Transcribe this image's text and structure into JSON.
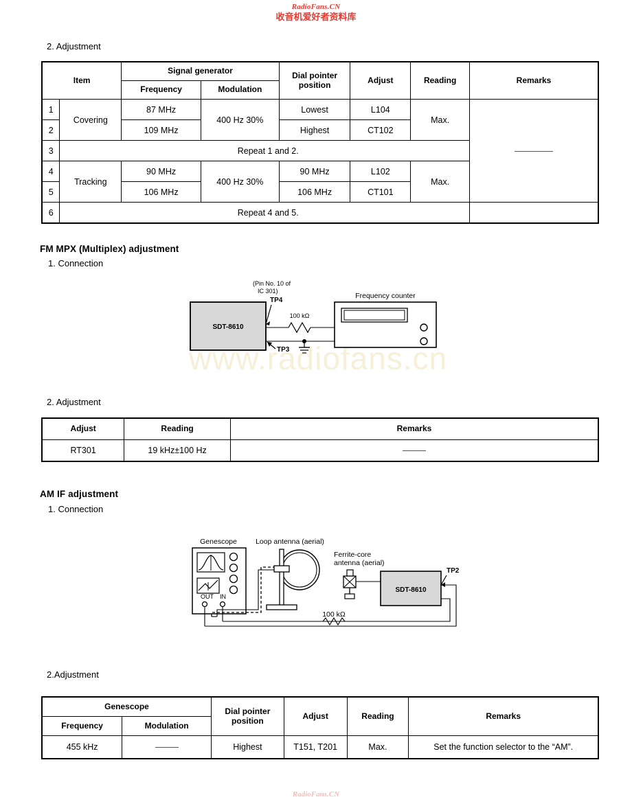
{
  "watermarks": {
    "top_latin": "RadioFans.CN",
    "top_cjk": "收音机爱好者资料库",
    "center": "www.radiofans.cn",
    "bottom": "RadioFans.CN"
  },
  "fm_rf": {
    "step_label": "2. Adjustment",
    "table": {
      "headers": {
        "item": "Item",
        "signal_generator": "Signal generator",
        "frequency": "Frequency",
        "modulation": "Modulation",
        "dial_pointer_position": "Dial pointer\nposition",
        "dial_pointer_line1": "Dial pointer",
        "dial_pointer_line2": "position",
        "adjust": "Adjust",
        "reading": "Reading",
        "remarks": "Remarks"
      },
      "rows": [
        {
          "no": "1",
          "item": "Covering",
          "frequency": "87 MHz",
          "modulation": "400 Hz 30%",
          "dial": "Lowest",
          "adjust": "L104",
          "reading": "Max."
        },
        {
          "no": "2",
          "item": "Covering",
          "frequency": "109 MHz",
          "modulation": "400 Hz 30%",
          "dial": "Highest",
          "adjust": "CT102",
          "reading": "Max."
        },
        {
          "no": "3",
          "span_text": "Repeat 1 and 2."
        },
        {
          "no": "4",
          "item": "Tracking",
          "frequency": "90 MHz",
          "modulation": "400 Hz 30%",
          "dial": "90 MHz",
          "adjust": "L102",
          "reading": "Max."
        },
        {
          "no": "5",
          "item": "Tracking",
          "frequency": "106 MHz",
          "modulation": "400 Hz 30%",
          "dial": "106 MHz",
          "adjust": "CT101",
          "reading": "Max."
        },
        {
          "no": "6",
          "span_text": "Repeat 4 and 5."
        }
      ],
      "remarks_value": "—"
    }
  },
  "fm_mpx": {
    "heading": "FM MPX (Multiplex) adjustment",
    "connection_label": "1. Connection",
    "diagram": {
      "unit_label": "SDT-8610",
      "pin_note_line1": "(Pin No. 10 of",
      "pin_note_line2": "IC 301)",
      "tp4": "TP4",
      "tp3": "TP3",
      "resistor": "100 kΩ",
      "counter_label": "Frequency counter"
    },
    "step_label": "2. Adjustment",
    "table": {
      "headers": {
        "adjust": "Adjust",
        "reading": "Reading",
        "remarks": "Remarks"
      },
      "rows": [
        {
          "adjust": "RT301",
          "reading": "19 kHz±100 Hz",
          "remarks": "—"
        }
      ]
    }
  },
  "am_if": {
    "heading": "AM IF adjustment",
    "connection_label": "1. Connection",
    "diagram": {
      "genescope_label": "Genescope",
      "loop_antenna_label": "Loop antenna (aerial)",
      "ferrite_line1": "Ferrite-core",
      "ferrite_line2": "antenna (aerial)",
      "out_label": "OUT",
      "in_label": "IN",
      "unit_label": "SDT-8610",
      "tp2": "TP2",
      "resistor": "100 kΩ"
    },
    "step_label": "2.Adjustment",
    "table": {
      "headers": {
        "genescope": "Genescope",
        "frequency": "Frequency",
        "modulation": "Modulation",
        "dial_pointer_line1": "Dial pointer",
        "dial_pointer_line2": "position",
        "adjust": "Adjust",
        "reading": "Reading",
        "remarks": "Remarks"
      },
      "rows": [
        {
          "frequency": "455 kHz",
          "modulation": "—",
          "dial": "Highest",
          "adjust": "T151, T201",
          "reading": "Max.",
          "remarks": "Set the function selector to the “AM”."
        }
      ]
    }
  }
}
